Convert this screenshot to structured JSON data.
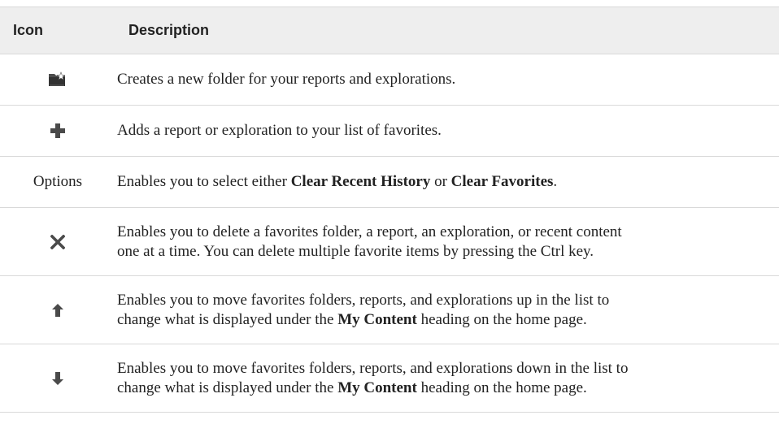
{
  "table": {
    "header": {
      "icon_label": "Icon",
      "description_label": "Description"
    },
    "rows": [
      {
        "icon": "new-folder-icon",
        "text": "Creates a new folder for your reports and explorations."
      },
      {
        "icon": "plus-icon",
        "text": "Adds a report or exploration to your list of favorites."
      },
      {
        "icon_text": "Options",
        "text_before": "Enables you to select either ",
        "bold_1": "Clear Recent History",
        "text_middle": " or ",
        "bold_2": "Clear Favorites",
        "text_after": "."
      },
      {
        "icon": "delete-x-icon",
        "line_1": "Enables you to delete a favorites folder, a report, an exploration, or recent content",
        "line_2": "one at a time. You can delete multiple favorite items by pressing the Ctrl key."
      },
      {
        "icon": "arrow-up-icon",
        "line_1": "Enables you to move favorites folders, reports, and explorations up in the list to",
        "line_2_before": "change what is displayed under the ",
        "line_2_bold": "My Content",
        "line_2_after": " heading on the home page."
      },
      {
        "icon": "arrow-down-icon",
        "line_1": "Enables you to move favorites folders, reports, and explorations down in the list to",
        "line_2_before": "change what is displayed under the ",
        "line_2_bold": "My Content",
        "line_2_after": " heading on the home page."
      }
    ]
  },
  "colors": {
    "header_background": "#eeeeee",
    "rule": "#d9d9d9",
    "text": "#222222",
    "icon_dark": "#4a4a4a"
  }
}
